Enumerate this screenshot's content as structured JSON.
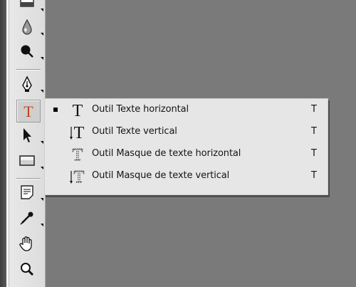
{
  "menu": {
    "items": [
      {
        "label": "Outil Texte horizontal",
        "shortcut": "T",
        "selected": true,
        "icon": "type-horizontal-icon"
      },
      {
        "label": "Outil Texte vertical",
        "shortcut": "T",
        "selected": false,
        "icon": "type-vertical-icon"
      },
      {
        "label": "Outil Masque de texte horizontal",
        "shortcut": "T",
        "selected": false,
        "icon": "type-mask-horizontal-icon"
      },
      {
        "label": "Outil Masque de texte vertical",
        "shortcut": "T",
        "selected": false,
        "icon": "type-mask-vertical-icon"
      }
    ]
  },
  "toolbar": {
    "active_tool": "type-tool",
    "tools": [
      "gradient-tool",
      "blur-tool",
      "dodge-tool",
      "pen-tool",
      "type-tool",
      "path-selection-tool",
      "rectangle-tool",
      "notes-tool",
      "eyedropper-tool",
      "hand-tool",
      "zoom-tool"
    ]
  },
  "colors": {
    "canvas_bg": "#7a7a7a",
    "toolbar_bg": "#e4e4e4",
    "menu_bg": "#e6e6e6",
    "type_icon_active": "#c0431c"
  }
}
